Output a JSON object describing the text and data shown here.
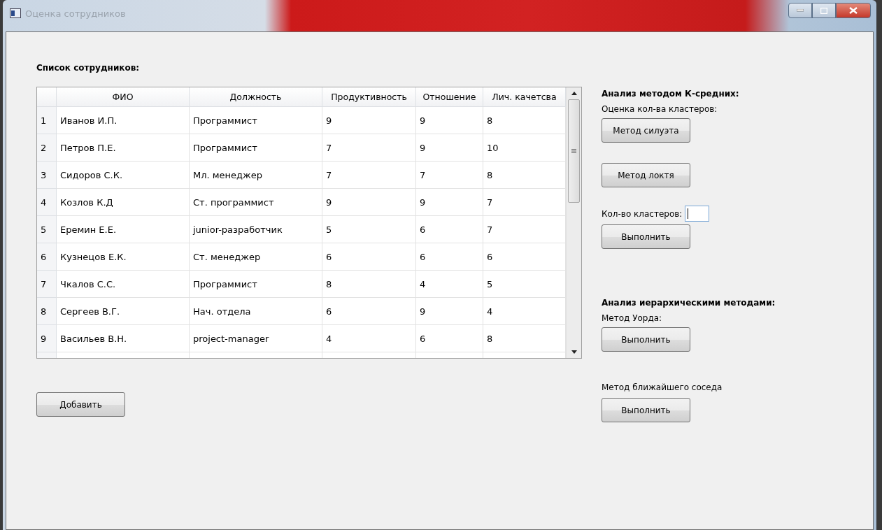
{
  "window": {
    "title": "Оценка сотрудников"
  },
  "employees": {
    "label": "Список сотрудников:",
    "table": {
      "columns": [
        "ФИО",
        "Должность",
        "Продуктивность",
        "Отношение",
        "Лич. качетсва"
      ],
      "rows": [
        {
          "number": "1",
          "cells": [
            "Иванов И.П.",
            "Программист",
            "9",
            "9",
            "8"
          ]
        },
        {
          "number": "2",
          "cells": [
            "Петров П.Е.",
            "Программист",
            "7",
            "9",
            "10"
          ]
        },
        {
          "number": "3",
          "cells": [
            "Сидоров С.К.",
            "Мл. менеджер",
            "7",
            "7",
            "8"
          ]
        },
        {
          "number": "4",
          "cells": [
            "Козлов К.Д",
            "Ст. программист",
            "9",
            "9",
            "7"
          ]
        },
        {
          "number": "5",
          "cells": [
            "Еремин Е.Е.",
            "junior-разработчик",
            "5",
            "6",
            "7"
          ]
        },
        {
          "number": "6",
          "cells": [
            "Кузнецов Е.К.",
            "Ст. менеджер",
            "6",
            "6",
            "6"
          ]
        },
        {
          "number": "7",
          "cells": [
            "Чкалов С.С.",
            "Программист",
            "8",
            "4",
            "5"
          ]
        },
        {
          "number": "8",
          "cells": [
            "Сергеев В.Г.",
            "Нач. отдела",
            "6",
            "9",
            "4"
          ]
        },
        {
          "number": "9",
          "cells": [
            "Васильев В.Н.",
            "project-manager",
            "4",
            "6",
            "8"
          ]
        }
      ]
    },
    "add_button": "Добавить"
  },
  "kmeans": {
    "heading": "Анализ методом К-средних:",
    "subheading": "Оценка кол-ва кластеров:",
    "silhouette_button": "Метод силуэта",
    "elbow_button": "Метод локтя",
    "cluster_count_label": "Кол-во кластеров:",
    "run_button": "Выполнить"
  },
  "hierarchical": {
    "heading": "Анализ иерархическими методами:",
    "ward_label": "Метод Уорда:",
    "ward_button": "Выполнить",
    "nearest_label": "Метод ближайшего соседа",
    "nearest_button": "Выполнить"
  }
}
